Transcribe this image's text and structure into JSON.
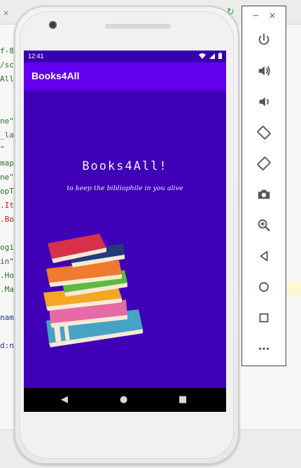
{
  "ide": {
    "code_fragments": [
      "f-8",
      "/sch",
      "All\"",
      "ne\"",
      "_la",
      "\"",
      "map/",
      "ne\"",
      "opTh",
      ".It",
      ".Bo",
      "ogin",
      "in\"",
      ".Ho",
      ".Ma",
      "nam",
      "d:n"
    ]
  },
  "phone": {
    "status": {
      "time": "12:41"
    },
    "appbar": {
      "title": "Books4All"
    },
    "content": {
      "app_name": "Books4All!",
      "tagline": "to keep the bibliophile in you alive"
    },
    "navbar": {
      "back": "◀",
      "home": "●",
      "recents": "■"
    }
  },
  "emulator": {
    "minimize": "−",
    "close": "×",
    "buttons": [
      "power-icon",
      "volume-up-icon",
      "volume-down-icon",
      "rotate-left-icon",
      "rotate-right-icon",
      "camera-icon",
      "zoom-icon",
      "back-icon",
      "home-icon",
      "overview-icon",
      "more-icon"
    ]
  }
}
